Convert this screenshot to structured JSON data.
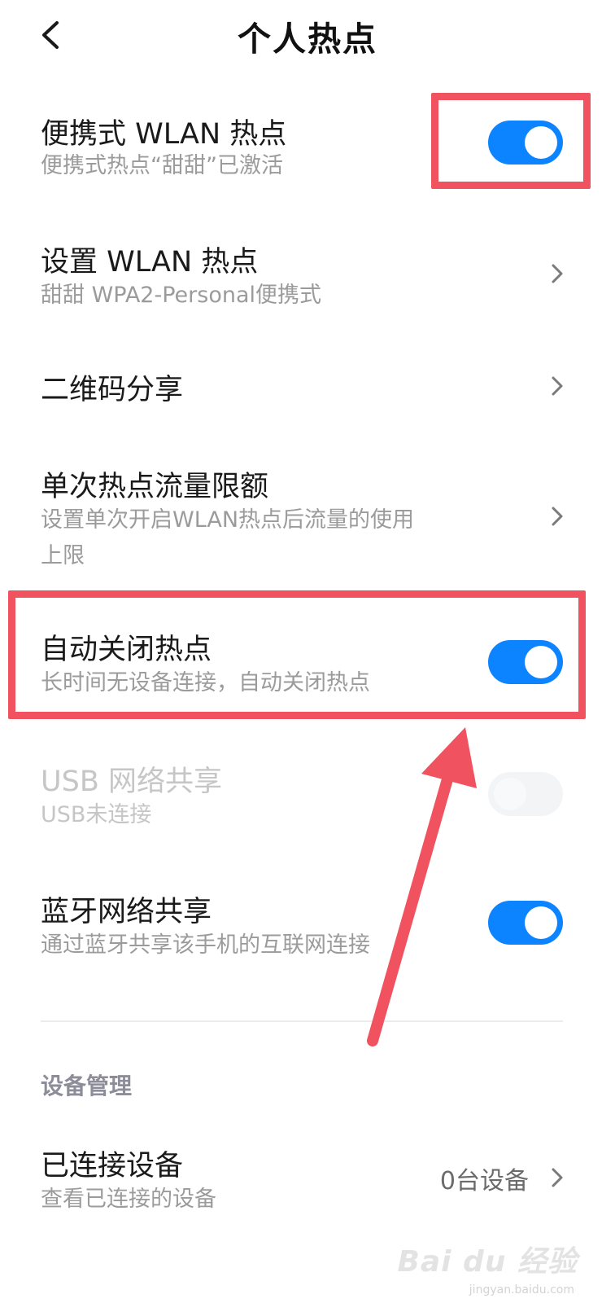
{
  "header": {
    "title": "个人热点",
    "back_icon": "chevron-left-icon"
  },
  "rows": [
    {
      "title": "便携式 WLAN 热点",
      "subtitle": "便携式热点“甜甜”已激活",
      "control": "toggle",
      "on": true
    },
    {
      "title": "设置 WLAN 热点",
      "subtitle": "甜甜 WPA2-Personal便携式",
      "control": "chevron"
    },
    {
      "title": "二维码分享",
      "control": "chevron"
    },
    {
      "title": "单次热点流量限额",
      "subtitle_lines": [
        "设置单次开启WLAN热点后流量的使用",
        "上限"
      ],
      "control": "chevron"
    },
    {
      "title": "自动关闭热点",
      "subtitle": "长时间无设备连接，自动关闭热点",
      "control": "toggle",
      "on": true
    },
    {
      "title": "USB 网络共享",
      "subtitle": "USB未连接",
      "control": "toggle",
      "on": false,
      "disabled": true
    },
    {
      "title": "蓝牙网络共享",
      "subtitle": "通过蓝牙共享该手机的互联网连接",
      "control": "toggle",
      "on": true
    }
  ],
  "section": {
    "label": "设备管理"
  },
  "connected": {
    "title": "已连接设备",
    "subtitle": "查看已连接的设备",
    "value": "0台设备"
  },
  "colors": {
    "toggle_on": "#0d84ff",
    "highlight": "#f0525f",
    "annotation_arrow": "#f0525f"
  },
  "watermark": {
    "text": "Bai du 经验",
    "sub": "jingyan.baidu.com"
  }
}
